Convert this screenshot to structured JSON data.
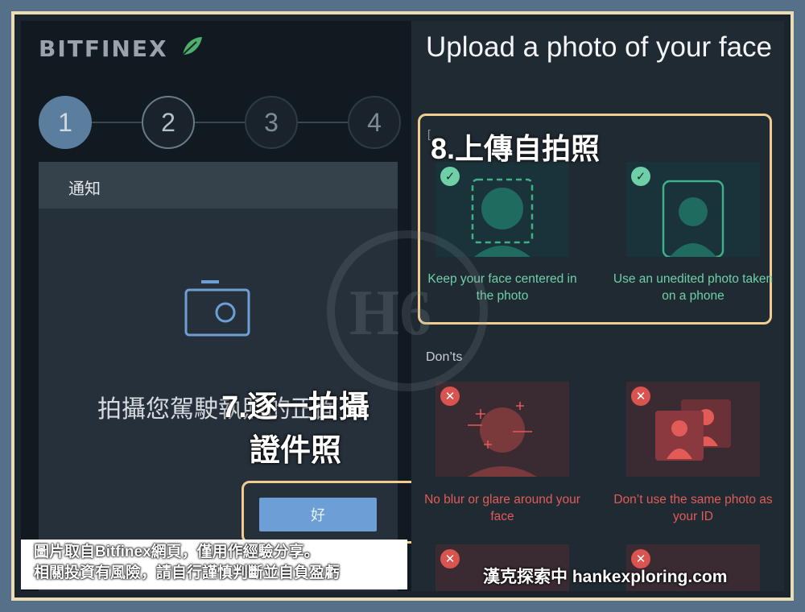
{
  "brand": {
    "logo_text": "BITFINEX",
    "leaf_color": "#4caf6a"
  },
  "steps": [
    "1",
    "2",
    "3",
    "4"
  ],
  "dialog": {
    "header": "通知",
    "message": "拍攝您駕駛執照的正面",
    "ok_label": "好"
  },
  "right": {
    "title": "Upload a photo of your face",
    "dos": [
      {
        "caption": "Keep your face centered in the photo",
        "icon": "face-frame-icon"
      },
      {
        "caption": "Use an unedited photo taken on a phone",
        "icon": "phone-portrait-icon"
      }
    ],
    "donts_label": "Don’ts",
    "donts": [
      {
        "caption": "No blur or glare around your face",
        "icon": "blurred-face-icon"
      },
      {
        "caption": "Don’t use the same photo as your ID",
        "icon": "id-photo-icon"
      }
    ],
    "bracket": "[",
    "colors": {
      "good": "#6fd0a8",
      "bad": "#e25b57"
    }
  },
  "annotations": {
    "step7": "7.逐一拍攝證件照",
    "step8": "8.上傳自拍照"
  },
  "watermark": "H6",
  "footer": {
    "line1": "圖片取自Bitfinex網頁，僅用作經驗分享。",
    "line2": "相關投資有風險，請自行謹慎判斷並自負盈虧",
    "site": "漢克探索中 hankexploring.com"
  }
}
